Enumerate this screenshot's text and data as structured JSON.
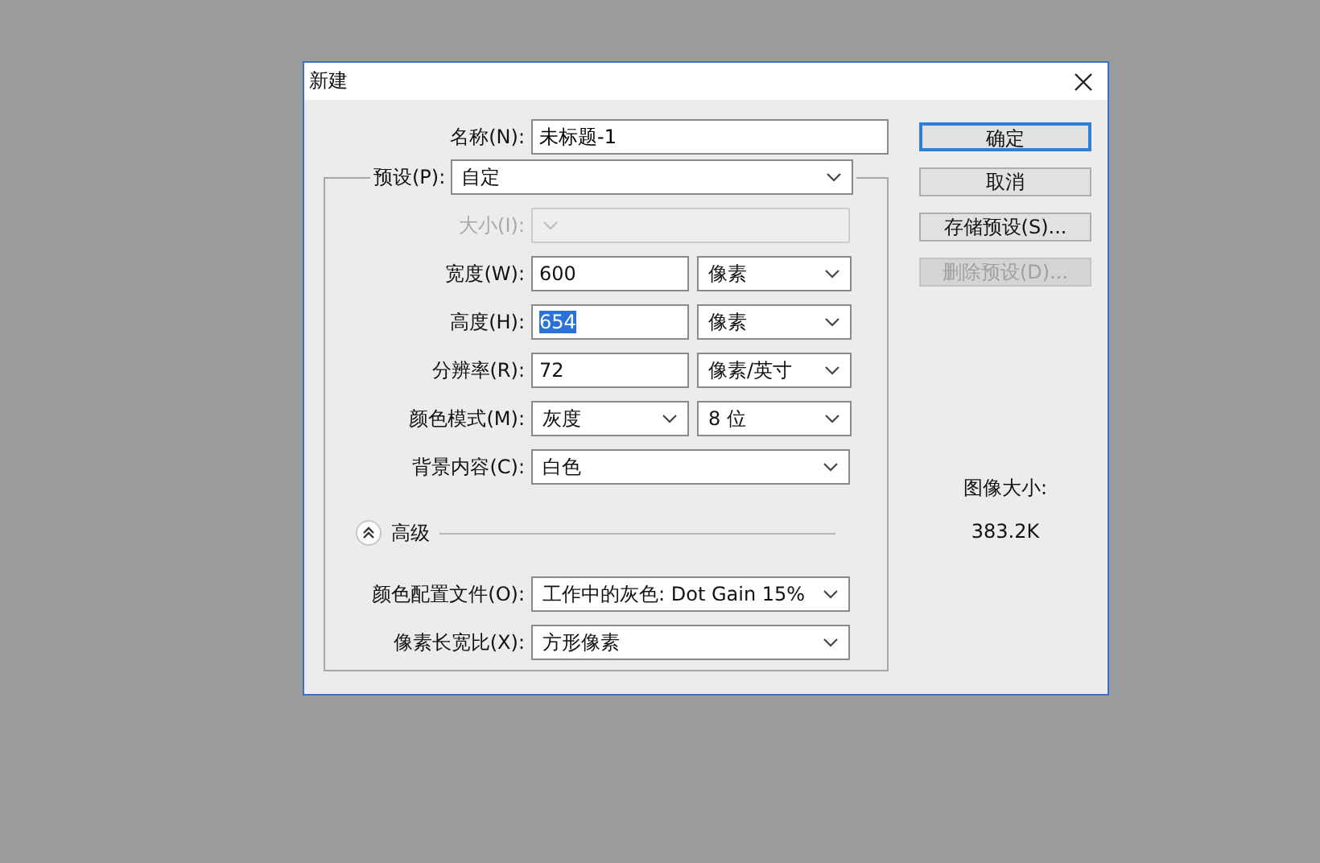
{
  "window": {
    "title": "新建"
  },
  "name": {
    "label": "名称(N):",
    "value": "未标题-1"
  },
  "preset": {
    "label": "预设(P):",
    "value": "自定"
  },
  "fields": [
    {
      "kind": "select",
      "label": "大小(I):",
      "disabled": true
    },
    {
      "kind": "input",
      "label": "宽度(W):",
      "value": "600",
      "unit": "像素",
      "disabled": false,
      "text_selected": false
    },
    {
      "kind": "input",
      "label": "高度(H):",
      "value": "654",
      "unit": "像素",
      "disabled": false,
      "text_selected": true
    },
    {
      "kind": "input",
      "label": "分辨率(R):",
      "value": "72",
      "unit": "像素/英寸",
      "disabled": false,
      "text_selected": false
    },
    {
      "kind": "pair",
      "label": "颜色模式(M):",
      "value": "灰度",
      "unit": "8 位",
      "disabled": false
    },
    {
      "kind": "select",
      "label": "背景内容(C):",
      "value": "白色",
      "disabled": false
    }
  ],
  "advanced": {
    "label": "高级",
    "expanded": true
  },
  "advanced_fields": [
    {
      "label": "颜色配置文件(O):",
      "value": "工作中的灰色: Dot Gain 15%"
    },
    {
      "label": "像素长宽比(X):",
      "value": "方形像素"
    }
  ],
  "buttons": [
    {
      "label": "确定",
      "default": true,
      "disabled": false
    },
    {
      "label": "取消",
      "default": false,
      "disabled": false
    },
    {
      "label": "存储预设(S)...",
      "default": false,
      "disabled": false
    },
    {
      "label": "删除预设(D)...",
      "default": false,
      "disabled": true
    }
  ],
  "image_size": {
    "label": "图像大小:",
    "value": "383.2K"
  }
}
